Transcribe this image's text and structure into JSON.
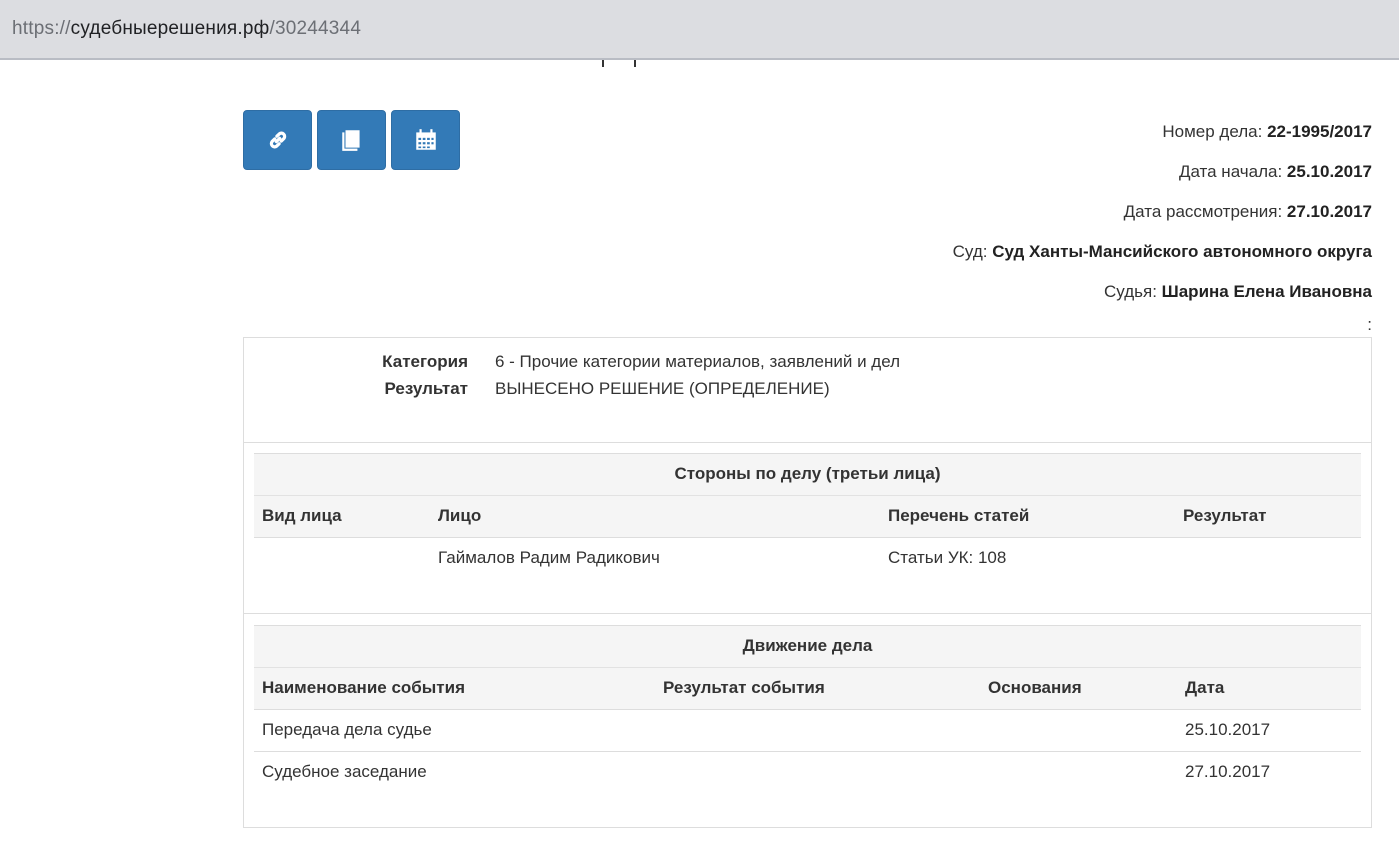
{
  "browser": {
    "url_scheme": "https://",
    "url_host": "судебныерешения.рф",
    "url_path": "/30244344"
  },
  "toolbar": {
    "buttons": [
      {
        "name": "link",
        "icon": "link-icon"
      },
      {
        "name": "book",
        "icon": "book-icon"
      },
      {
        "name": "calendar",
        "icon": "calendar-icon"
      }
    ],
    "color": "#337ab7"
  },
  "case": {
    "number_label": "Номер дела: ",
    "number": "22-1995/2017",
    "start_label": "Дата начала: ",
    "start": "25.10.2017",
    "review_label": "Дата рассмотрения: ",
    "review": "27.10.2017",
    "court_label": "Суд: ",
    "court": "Суд Ханты-Мансийского автономного округа",
    "judge_label": "Судья: ",
    "judge": "Шарина Елена Ивановна",
    "trailing": ":"
  },
  "info": {
    "category_label": "Категория",
    "category": "6 - Прочие категории материалов, заявлений и дел",
    "result_label": "Результат",
    "result": "ВЫНЕСЕНО РЕШЕНИЕ (ОПРЕДЕЛЕНИЕ)"
  },
  "parties": {
    "title": "Стороны по делу (третьи лица)",
    "columns": [
      "Вид лица",
      "Лицо",
      "Перечень статей",
      "Результат"
    ],
    "rows": [
      [
        "",
        "Гаймалов Радим Радикович",
        "Статьи УК: 108",
        ""
      ]
    ]
  },
  "movement": {
    "title": "Движение дела",
    "columns": [
      "Наименование события",
      "Результат события",
      "Основания",
      "Дата"
    ],
    "rows": [
      [
        "Передача дела судье",
        "",
        "",
        "25.10.2017"
      ],
      [
        "Судебное заседание",
        "",
        "",
        "27.10.2017"
      ]
    ]
  }
}
